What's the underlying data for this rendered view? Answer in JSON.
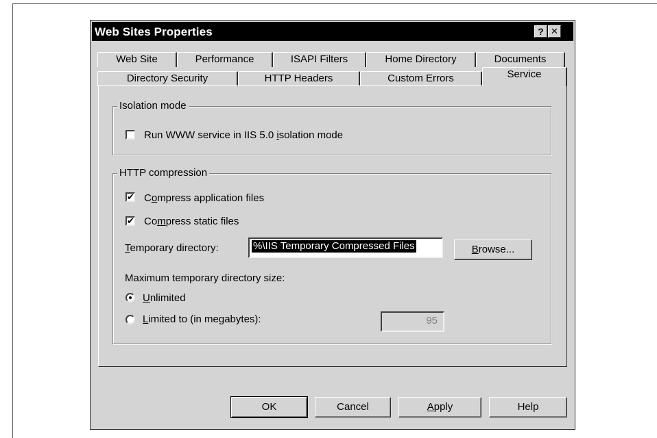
{
  "window": {
    "title": "Web Sites Properties",
    "help_glyph": "?",
    "close_glyph": "✕"
  },
  "tabs": {
    "row_back": [
      "Web Site",
      "Performance",
      "ISAPI Filters",
      "Home Directory",
      "Documents"
    ],
    "row_front": [
      "Directory Security",
      "HTTP Headers",
      "Custom Errors",
      "Service"
    ],
    "active": "Service"
  },
  "isolation": {
    "legend": "Isolation mode",
    "run_iis5_label_pre": "Run WWW service in IIS 5.0 ",
    "run_iis5_label_key": "i",
    "run_iis5_label_post": "solation mode",
    "run_iis5_checked": false
  },
  "compression": {
    "legend": "HTTP compression",
    "compress_app_pre": "C",
    "compress_app_key": "o",
    "compress_app_post": "mpress application files",
    "compress_app_checked": true,
    "compress_static_pre": "Co",
    "compress_static_key": "m",
    "compress_static_post": "press static files",
    "compress_static_checked": true,
    "temp_dir_key": "T",
    "temp_dir_rest": "emporary directory:",
    "temp_dir_value": "%\\IIS Temporary Compressed Files",
    "browse_key": "B",
    "browse_rest": "rowse...",
    "max_size_label": "Maximum temporary directory size:",
    "unlimited_key": "U",
    "unlimited_rest": "nlimited",
    "unlimited_selected": true,
    "limited_key": "L",
    "limited_rest": "imited to (in megabytes):",
    "limited_selected": false,
    "limited_value": "95"
  },
  "buttons": {
    "ok": "OK",
    "cancel": "Cancel",
    "apply_key": "A",
    "apply_rest": "pply",
    "help": "Help"
  }
}
